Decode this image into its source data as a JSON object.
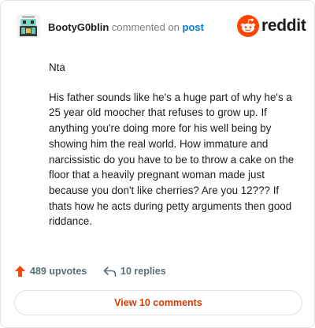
{
  "header": {
    "username": "BootyG0blin",
    "commented_text": "commented on",
    "post_link": "post",
    "brand": "reddit"
  },
  "comment": {
    "paragraphs": [
      "Nta",
      "His father sounds like he's a huge part of why he's a 25 year old moocher that refuses to grow up. If anything you're doing more for his well being by showing him the real world. How immature and narcissistic do you have to be to throw a cake on the floor that a heavily pregnant woman made just because you don't like cherries? Are you 12??? If thats how he acts during petty arguments then good riddance."
    ]
  },
  "actions": {
    "upvotes": "489 upvotes",
    "replies": "10 replies"
  },
  "footer": {
    "view_comments": "View 10 comments"
  },
  "colors": {
    "brand_orange": "#ff4500",
    "link_blue": "#0079d3",
    "action_gray": "#576f76",
    "view_button_text": "#d93a00"
  },
  "icons": [
    "avatar-image",
    "reddit-snoo-icon",
    "upvote-arrow-icon",
    "reply-arrow-icon"
  ]
}
